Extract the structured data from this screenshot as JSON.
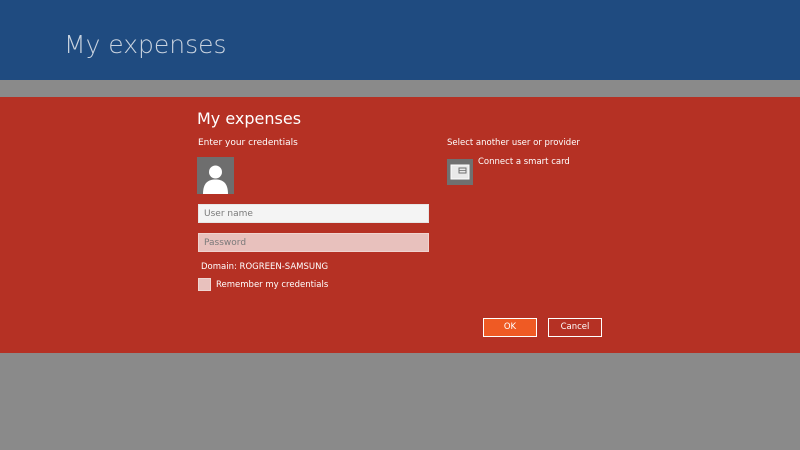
{
  "app": {
    "title": "My expenses"
  },
  "dialog": {
    "title": "My expenses",
    "subtitle": "Enter your credentials",
    "username_placeholder": "User name",
    "password_placeholder": "Password",
    "domain": "Domain: ROGREEN-SAMSUNG",
    "remember_label": "Remember my credentials",
    "remember_checked": false,
    "provider_heading": "Select another user or provider",
    "smartcard_label": "Connect a smart card",
    "ok_label": "OK",
    "cancel_label": "Cancel"
  },
  "colors": {
    "top_bar": "#1f4b80",
    "dialog": "#b53124",
    "background": "#8a8a8a",
    "ok_button": "#ef5a24"
  },
  "icons": {
    "avatar": "user-silhouette-icon",
    "smartcard": "smart-card-icon"
  }
}
